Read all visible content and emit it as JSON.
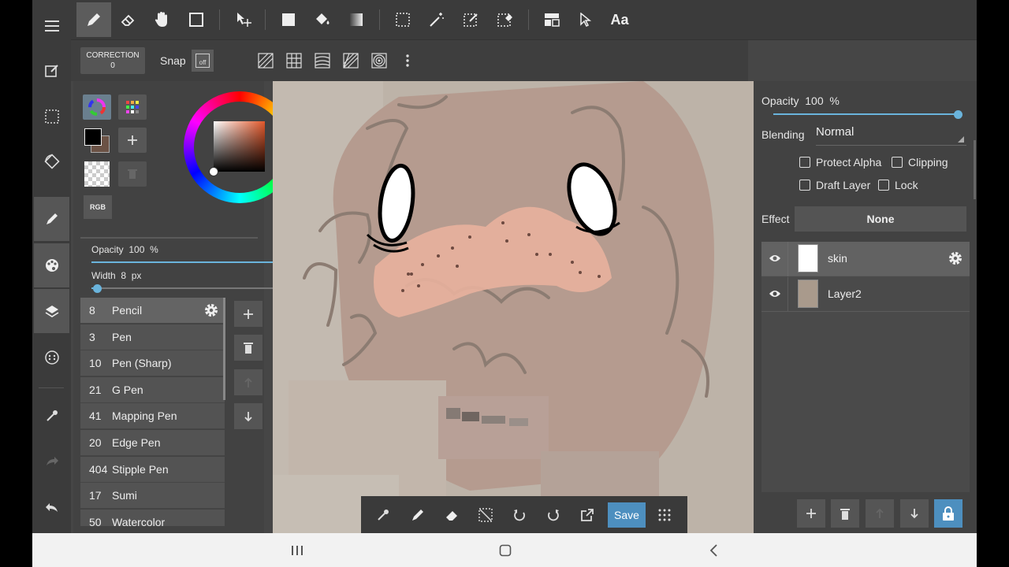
{
  "toolbar": {
    "correction_label": "CORRECTION",
    "correction_value": "0",
    "snap_label": "Snap",
    "snap_off": "off",
    "text_tool": "Aa"
  },
  "brush_panel": {
    "rgb_label": "RGB",
    "opacity_label": "Opacity",
    "opacity_value": "100",
    "opacity_unit": "%",
    "opacity_level": 1.0,
    "width_label": "Width",
    "width_value": "8",
    "width_unit": "px",
    "width_level": 0.03,
    "brushes": [
      {
        "size": "8",
        "name": "Pencil"
      },
      {
        "size": "3",
        "name": "Pen"
      },
      {
        "size": "10",
        "name": "Pen (Sharp)"
      },
      {
        "size": "21",
        "name": "G Pen"
      },
      {
        "size": "41",
        "name": "Mapping Pen"
      },
      {
        "size": "20",
        "name": "Edge Pen"
      },
      {
        "size": "404",
        "name": "Stipple Pen"
      },
      {
        "size": "17",
        "name": "Sumi"
      },
      {
        "size": "50",
        "name": "Watercolor"
      }
    ]
  },
  "bottom_toolbar": {
    "save_label": "Save"
  },
  "layer_panel": {
    "opacity_label": "Opacity",
    "opacity_value": "100",
    "opacity_unit": "%",
    "opacity_level": 1.0,
    "blending_label": "Blending",
    "blending_value": "Normal",
    "protect_alpha": "Protect Alpha",
    "clipping": "Clipping",
    "draft_layer": "Draft Layer",
    "lock": "Lock",
    "effect_label": "Effect",
    "effect_value": "None",
    "layers": [
      {
        "name": "skin"
      },
      {
        "name": "Layer2"
      }
    ]
  },
  "colors": {
    "accent": "#4d8fbf",
    "slider": "#6ab4dc",
    "panel": "#424242",
    "toolbar": "#3b3b3b"
  }
}
